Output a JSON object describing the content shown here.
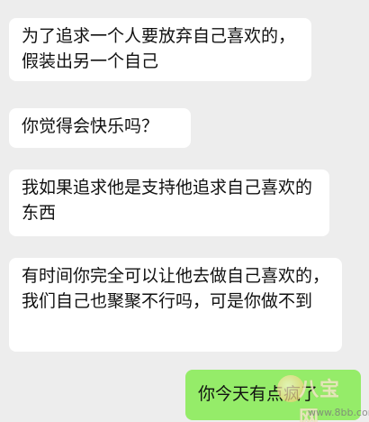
{
  "messages": [
    {
      "text": "为了追求一个人要放弃自己喜欢的，假装出另一个自己",
      "side": "left"
    },
    {
      "text": "你觉得会快乐吗？",
      "side": "left"
    },
    {
      "text": "我如果追求他是支持他追求自己喜欢的东西",
      "side": "left"
    },
    {
      "text": "有时间你完全可以让他去做自己喜欢的，我们自己也聚聚不行吗，可是你做不到",
      "side": "left"
    },
    {
      "text": "你今天有点疯了",
      "side": "right"
    }
  ],
  "colors": {
    "background": "#ededed",
    "incoming_bubble": "#ffffff",
    "outgoing_bubble": "#95ec69"
  },
  "watermark": {
    "brand": "八宝网",
    "url": "www.8bb.com"
  }
}
